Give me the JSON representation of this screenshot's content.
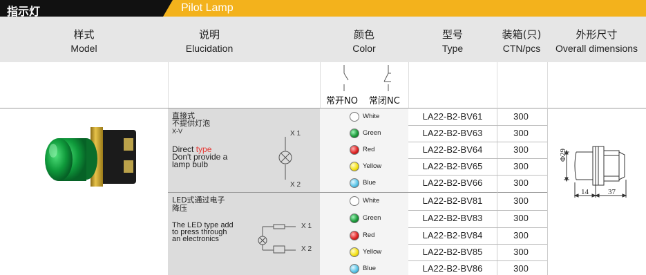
{
  "title": {
    "cn": "指示灯",
    "en": "Pilot Lamp"
  },
  "headers": [
    {
      "cn": "样式",
      "en": "Model"
    },
    {
      "cn": "说明",
      "en": "Elucidation"
    },
    {
      "cn": "颜色",
      "en": "Color"
    },
    {
      "cn": "型号",
      "en": "Type"
    },
    {
      "cn": "装箱(只)",
      "en": "CTN/pcs"
    },
    {
      "cn": "外形尺寸",
      "en": "Overall dimensions"
    }
  ],
  "contacts": {
    "no": "常开NO",
    "nc": "常闭NC"
  },
  "group1": {
    "cn_line1": "直接式",
    "cn_line2": "不提供灯泡",
    "code": "X-V",
    "en_line1": "Direct",
    "en_type": "type",
    "en_line2": "Don't provide a",
    "en_line3": "lamp bulb",
    "x1": "X 1",
    "x2": "X 2"
  },
  "group2": {
    "cn_line1": "LED式通过电子",
    "cn_line2": "降压",
    "en_line1": "The LED type add",
    "en_line2": "to press through",
    "en_line3": "an electronics",
    "x1": "X 1",
    "x2": "X 2"
  },
  "rows": [
    {
      "color": "White",
      "hex": "#ffffff",
      "type": "LA22-B2-BV61",
      "qty": "300"
    },
    {
      "color": "Green",
      "hex": "#1e9b3c",
      "type": "LA22-B2-BV63",
      "qty": "300"
    },
    {
      "color": "Red",
      "hex": "#e02525",
      "type": "LA22-B2-BV64",
      "qty": "300"
    },
    {
      "color": "Yellow",
      "hex": "#f5e31a",
      "type": "LA22-B2-BV65",
      "qty": "300"
    },
    {
      "color": "Blue",
      "hex": "#5ec6e8",
      "type": "LA22-B2-BV66",
      "qty": "300"
    },
    {
      "color": "White",
      "hex": "#ffffff",
      "type": "LA22-B2-BV81",
      "qty": "300"
    },
    {
      "color": "Green",
      "hex": "#1e9b3c",
      "type": "LA22-B2-BV83",
      "qty": "300"
    },
    {
      "color": "Red",
      "hex": "#e02525",
      "type": "LA22-B2-BV84",
      "qty": "300"
    },
    {
      "color": "Yellow",
      "hex": "#f5e31a",
      "type": "LA22-B2-BV85",
      "qty": "300"
    },
    {
      "color": "Blue",
      "hex": "#5ec6e8",
      "type": "LA22-B2-BV86",
      "qty": "300"
    }
  ],
  "dimensions": {
    "dia": "Φ29",
    "a": "14",
    "b": "37"
  },
  "colors": {
    "accent": "#f3b21c",
    "header_bg": "#e6e6e6",
    "gray": "#dcdcdc"
  }
}
